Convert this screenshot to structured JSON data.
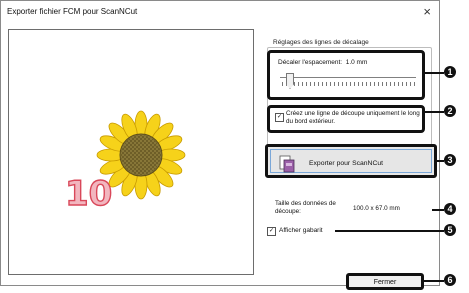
{
  "window": {
    "title": "Exporter fichier FCM pour ScanNCut",
    "close_glyph": "×"
  },
  "settings": {
    "legend": "Réglages des lignes de décalage",
    "offset_label": "Décaler l'espacement:  1.0 mm",
    "offset_value": "1.0 mm",
    "cut_line_checkbox_label": "Créez une ligne de découpe uniquement le long du bord extérieur.",
    "cut_line_checked": true
  },
  "export": {
    "button_label": "Exporter pour ScanNCut"
  },
  "info": {
    "size_label": "Taille des données de découpe:",
    "size_value": "100.0 x 67.0 mm"
  },
  "template": {
    "label": "Afficher gabarit",
    "checked": true
  },
  "buttons": {
    "close_label": "Fermer"
  },
  "callouts": [
    "1",
    "2",
    "3",
    "4",
    "5",
    "6"
  ],
  "preview": {
    "number_text": "10"
  },
  "colors": {
    "petal": "#f6d21a",
    "petal_stroke": "#c79a00",
    "number_fill": "#f2b6bf",
    "number_stroke": "#d9485a",
    "center": "#8b7a3a",
    "accent": "#7aa7d8"
  }
}
